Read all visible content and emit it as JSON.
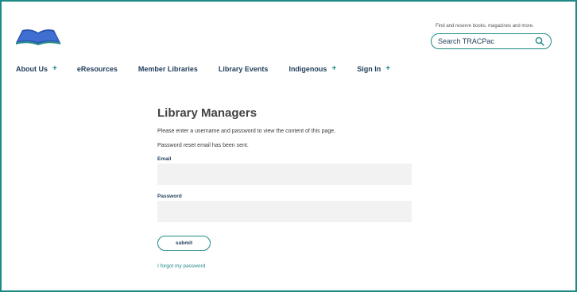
{
  "header": {
    "search_hint": "Find and reserve books, magazines and more.",
    "search_placeholder": "Search TRACPac"
  },
  "nav": {
    "items": [
      {
        "label": "About Us",
        "has_plus": true
      },
      {
        "label": "eResources",
        "has_plus": false
      },
      {
        "label": "Member Libraries",
        "has_plus": false
      },
      {
        "label": "Library Events",
        "has_plus": false
      },
      {
        "label": "Indigenous",
        "has_plus": true
      },
      {
        "label": "Sign In",
        "has_plus": true
      }
    ],
    "plus_symbol": "+"
  },
  "main": {
    "title": "Library Managers",
    "instruction": "Please enter a username and password to view the content of this page.",
    "reset_notice": "Password reset email has been sent.",
    "email_label": "Email",
    "email_value": "",
    "password_label": "Password",
    "password_value": "",
    "submit_label": "submit",
    "forgot_link": "I forgot my password"
  },
  "colors": {
    "accent": "#1e8a86",
    "nav_text": "#1f3d5a",
    "field_bg": "#f2f2f2"
  },
  "icons": [
    "logo-icon",
    "search-icon"
  ]
}
